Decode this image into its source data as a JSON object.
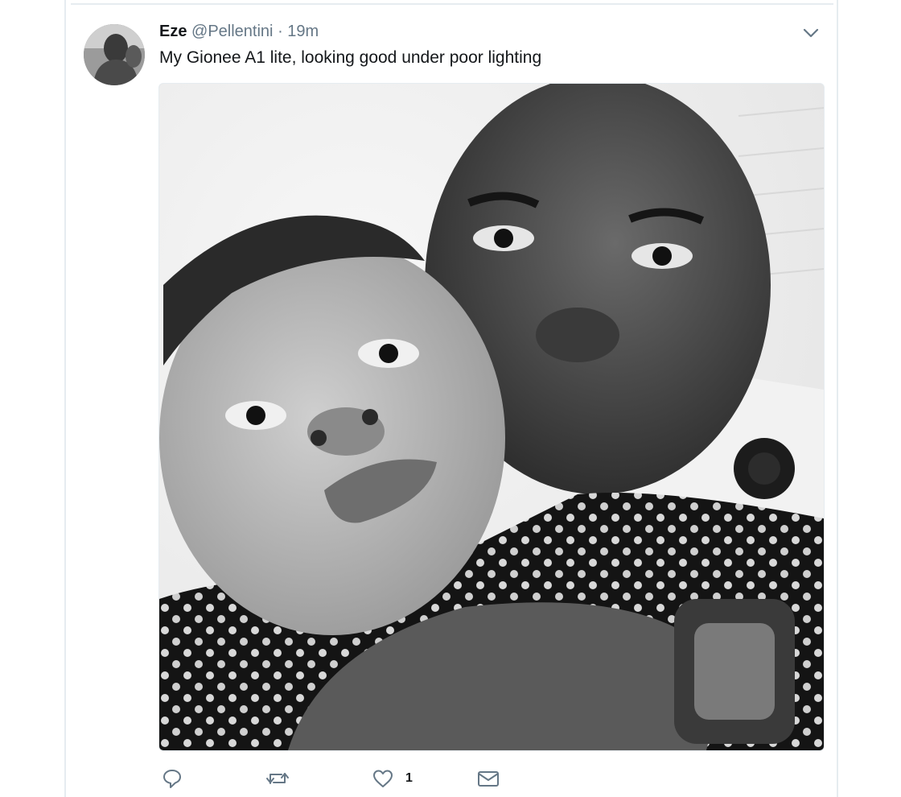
{
  "tweet": {
    "display_name": "Eze",
    "handle": "@Pellentini",
    "separator": "·",
    "time": "19m",
    "text": "My Gionee A1 lite, looking good under poor lighting",
    "actions": {
      "reply_icon": "reply-icon",
      "retweet_icon": "retweet-icon",
      "like_icon": "heart-icon",
      "like_count": "1",
      "message_icon": "envelope-icon"
    },
    "menu_icon": "chevron-down-icon"
  },
  "colors": {
    "text": "#14171a",
    "secondary": "#657786",
    "border": "#e6ecf0",
    "icon": "#657786"
  }
}
